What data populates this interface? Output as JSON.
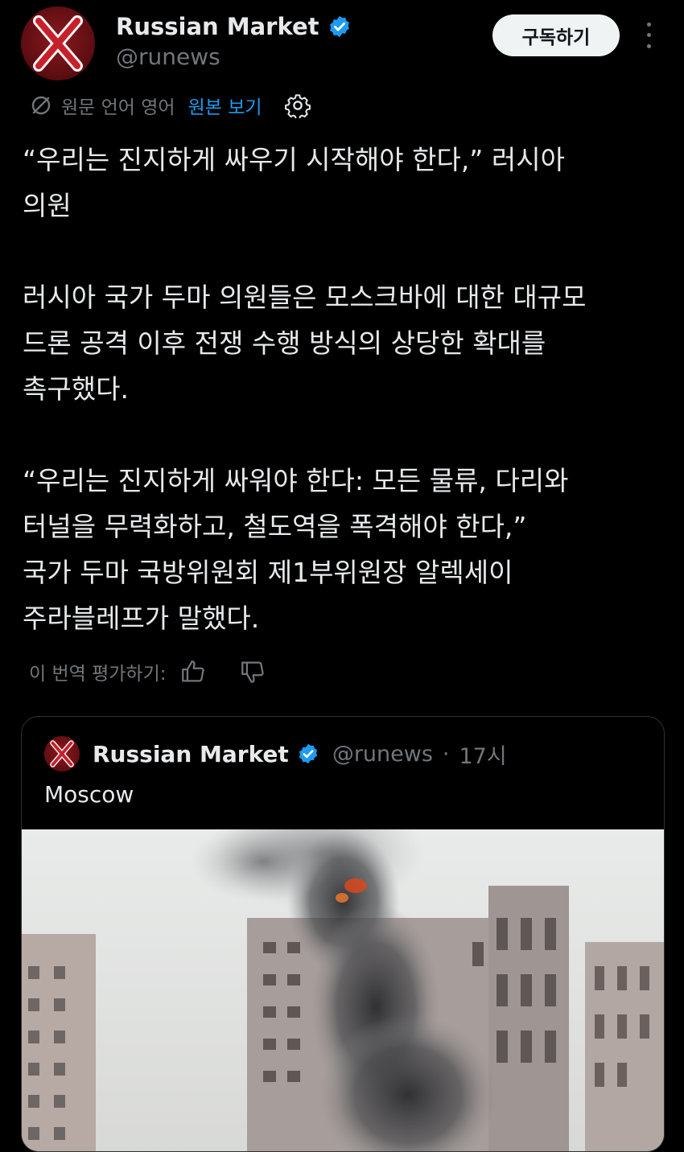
{
  "post": {
    "display_name": "Russian Market",
    "handle": "@runews",
    "subscribe_label": "구독하기"
  },
  "translation_bar": {
    "source_language": "원문 언어 영어",
    "show_original_label": "원본 보기"
  },
  "body": {
    "paragraphs": [
      [
        "“우리는 진지하게 싸우기 시작해야 한다,” 러시아",
        "의원"
      ],
      [
        "러시아 국가 두마 의원들은 모스크바에 대한 대규모",
        "드론 공격 이후 전쟁 수행 방식의 상당한 확대를",
        "촉구했다."
      ],
      [
        "“우리는 진지하게 싸워야 한다: 모든 물류, 다리와",
        "터널을 무력화하고, 철도역을 폭격해야 한다,”",
        "국가 두마 국방위원회 제1부위원장 알렉세이",
        "주라블레프가 말했다."
      ]
    ]
  },
  "rate_translation": {
    "label": "이 번역 평가하기:"
  },
  "quoted_post": {
    "display_name": "Russian Market",
    "handle": "@runews",
    "separator": "·",
    "time": "17시",
    "text": "Moscow"
  },
  "colors": {
    "background": "#000000",
    "text": "#e7e9ea",
    "secondary_text": "#71767b",
    "link": "#1d9bf0",
    "verified_badge": "#1d9bf0",
    "avatar_red": "#8a1a1f"
  },
  "icons": {
    "verified": "verified-badge-icon",
    "more": "more-vertical-icon",
    "translate": "translate-icon",
    "settings": "gear-icon",
    "thumbs_up": "thumbs-up-icon",
    "thumbs_down": "thumbs-down-icon"
  }
}
